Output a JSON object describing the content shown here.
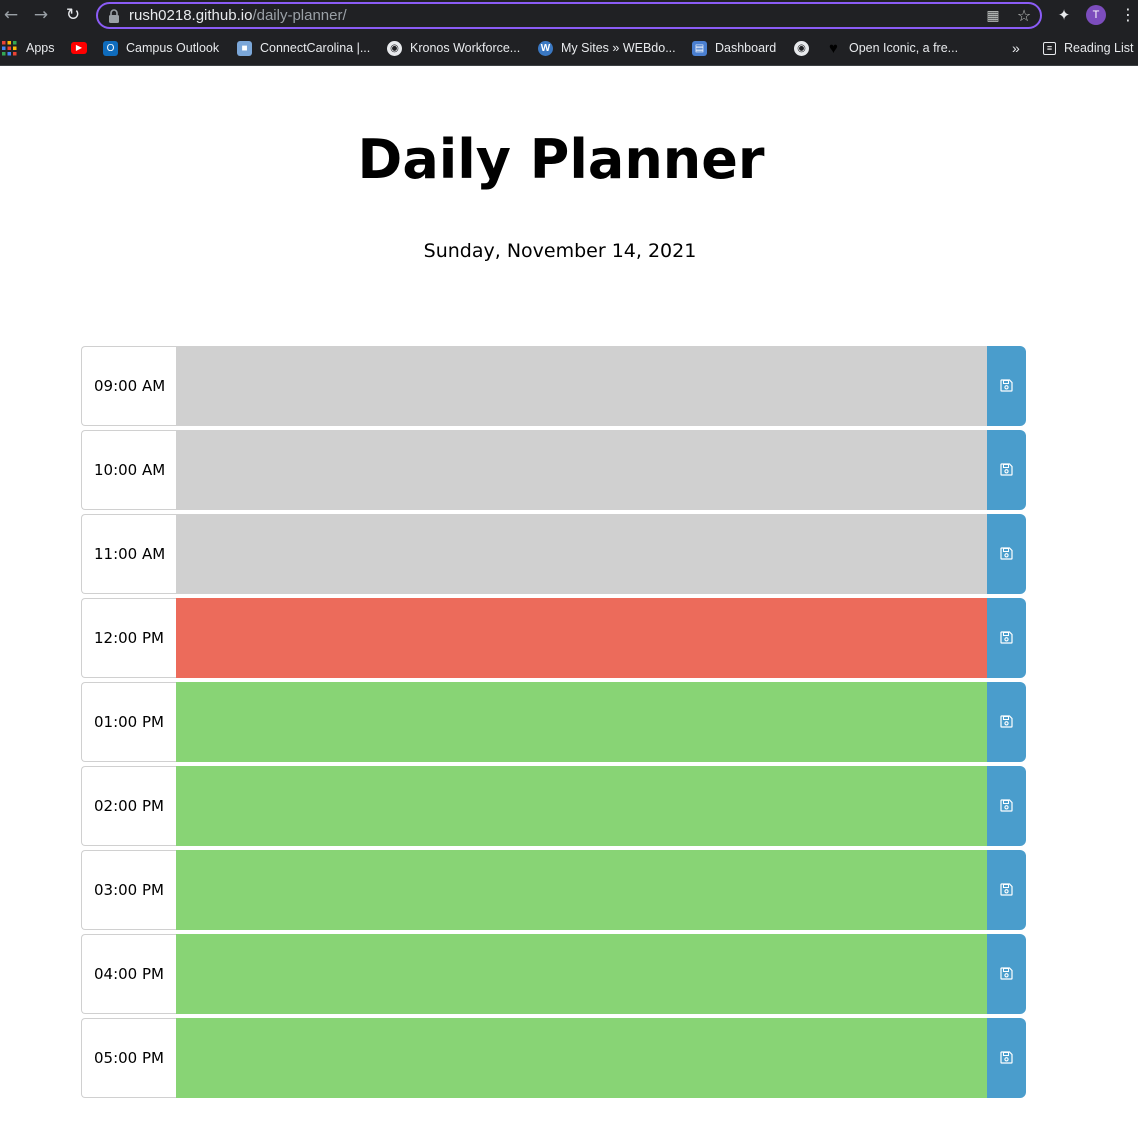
{
  "browser": {
    "url_host": "rush0218.github.io",
    "url_path": "/daily-planner/",
    "profile_initial": "T",
    "bookmarks": [
      {
        "label": "Apps",
        "icon": "apps-grid-icon"
      },
      {
        "label": "",
        "icon": "youtube-icon"
      },
      {
        "label": "Campus Outlook",
        "icon": "outlook-icon"
      },
      {
        "label": "ConnectCarolina |...",
        "icon": "connectcarolina-icon"
      },
      {
        "label": "Kronos Workforce...",
        "icon": "globe-icon"
      },
      {
        "label": "My Sites » WEBdo...",
        "icon": "wordpress-icon"
      },
      {
        "label": "Dashboard",
        "icon": "dashboard-icon"
      },
      {
        "label": "",
        "icon": "globe-icon"
      },
      {
        "label": "Open Iconic, a fre...",
        "icon": "heart-icon"
      }
    ],
    "overflow_label": "»",
    "reading_list_label": "Reading List"
  },
  "header": {
    "title": "Daily Planner",
    "date": "Sunday, November 14, 2021"
  },
  "colors": {
    "past": "#d0d0d0",
    "present": "#ec6b5b",
    "future": "#88d475",
    "save": "#4a9dcc",
    "omnibox_focus": "#8b5cf6"
  },
  "timeblocks": [
    {
      "hour": "09:00 AM",
      "status": "past",
      "text": ""
    },
    {
      "hour": "10:00 AM",
      "status": "past",
      "text": ""
    },
    {
      "hour": "11:00 AM",
      "status": "past",
      "text": ""
    },
    {
      "hour": "12:00 PM",
      "status": "present",
      "text": ""
    },
    {
      "hour": "01:00 PM",
      "status": "future",
      "text": ""
    },
    {
      "hour": "02:00 PM",
      "status": "future",
      "text": ""
    },
    {
      "hour": "03:00 PM",
      "status": "future",
      "text": ""
    },
    {
      "hour": "04:00 PM",
      "status": "future",
      "text": ""
    },
    {
      "hour": "05:00 PM",
      "status": "future",
      "text": ""
    }
  ]
}
